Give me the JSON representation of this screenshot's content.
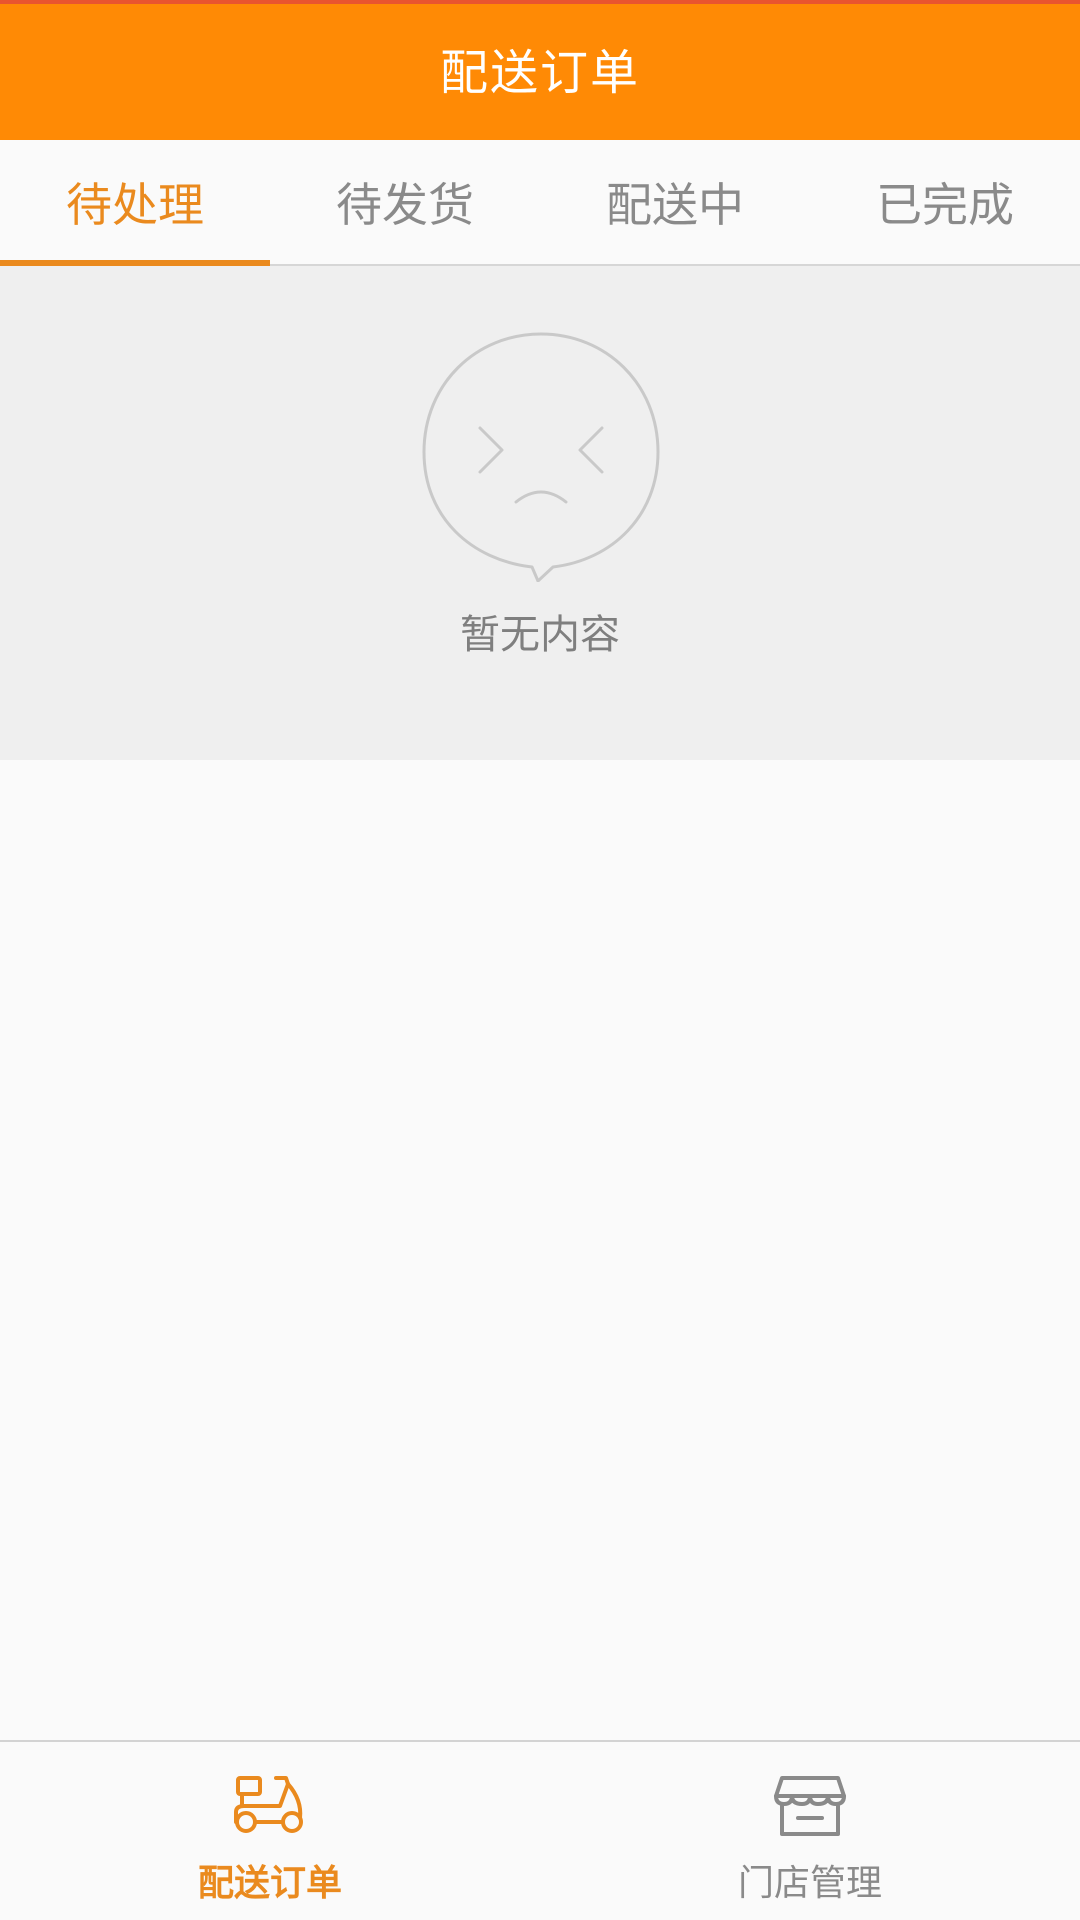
{
  "header": {
    "title": "配送订单"
  },
  "tabs": [
    {
      "label": "待处理",
      "active": true
    },
    {
      "label": "待发货",
      "active": false
    },
    {
      "label": "配送中",
      "active": false
    },
    {
      "label": "已完成",
      "active": false
    }
  ],
  "empty_state": {
    "icon": "sad-face-speech-bubble-icon",
    "message": "暂无内容"
  },
  "bottom_nav": [
    {
      "label": "配送订单",
      "icon": "scooter-icon",
      "active": true
    },
    {
      "label": "门店管理",
      "icon": "store-icon",
      "active": false
    }
  ],
  "colors": {
    "header_bg": "#ff8a05",
    "accent": "#ea8a1e",
    "inactive_text": "#8a8a8a"
  }
}
